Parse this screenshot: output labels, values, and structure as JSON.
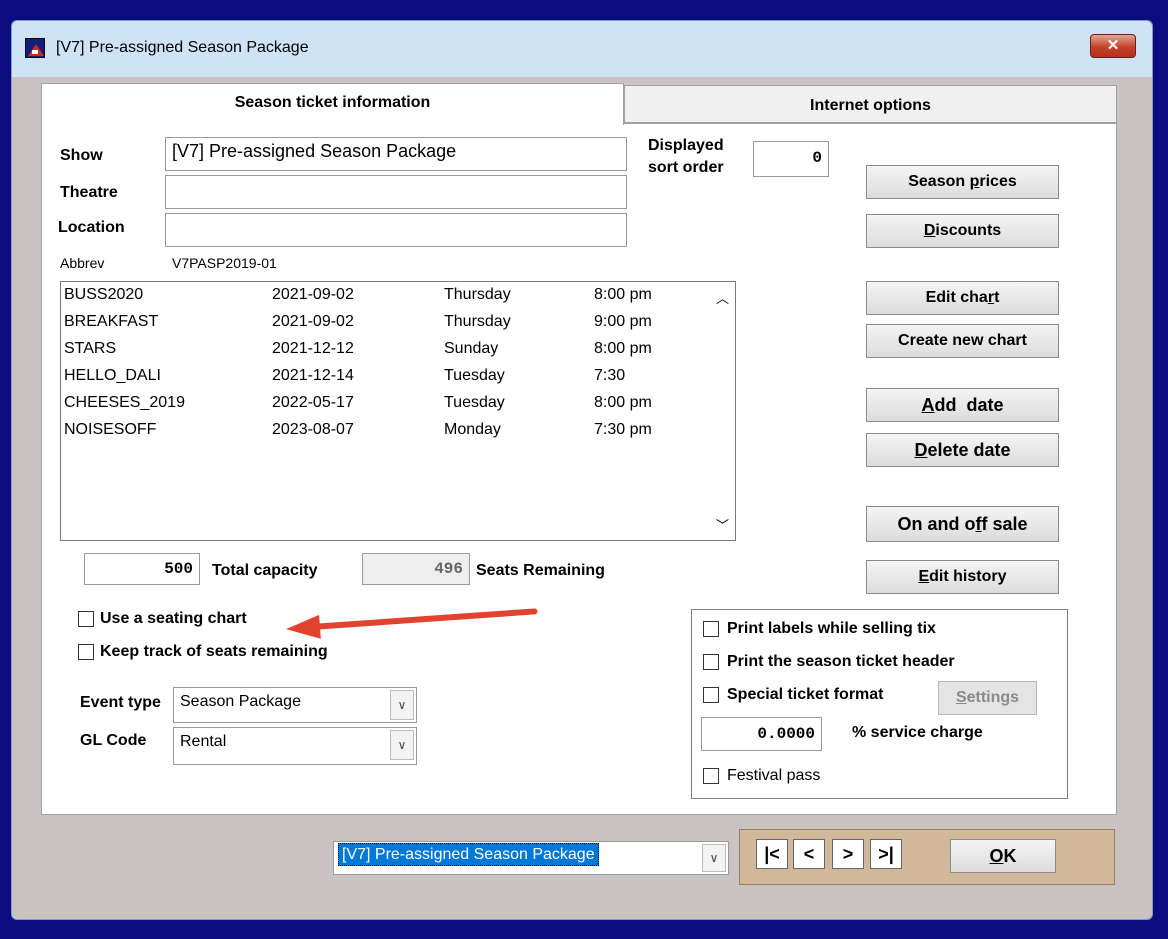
{
  "window": {
    "title": "[V7] Pre-assigned Season Package",
    "close_label": "✕"
  },
  "tabs": [
    {
      "label": "Season ticket information"
    },
    {
      "label": "Internet options"
    }
  ],
  "form": {
    "show_label": "Show",
    "show_value": "[V7] Pre-assigned Season Package",
    "theatre_label": "Theatre",
    "theatre_value": "",
    "location_label": "Location",
    "location_value": "",
    "abbrev_label": "Abbrev",
    "abbrev_value": "V7PASP2019-01",
    "sort_label_1": "Displayed",
    "sort_label_2": "sort order",
    "sort_value": "0"
  },
  "dates": [
    {
      "code": "BUSS2020",
      "date": "2021-09-02",
      "day": "Thursday",
      "time": "8:00 pm"
    },
    {
      "code": "BREAKFAST",
      "date": "2021-09-02",
      "day": "Thursday",
      "time": "9:00 pm"
    },
    {
      "code": "STARS",
      "date": "2021-12-12",
      "day": "Sunday",
      "time": "8:00 pm"
    },
    {
      "code": "HELLO_DALI",
      "date": "2021-12-14",
      "day": "Tuesday",
      "time": "7:30"
    },
    {
      "code": "CHEESES_2019",
      "date": "2022-05-17",
      "day": "Tuesday",
      "time": "8:00 pm"
    },
    {
      "code": "NOISESOFF",
      "date": "2023-08-07",
      "day": "Monday",
      "time": "7:30 pm"
    }
  ],
  "scroll": {
    "up": "︿",
    "down": "﹀"
  },
  "capacity": {
    "total_value": "500",
    "total_label": "Total capacity",
    "remaining_value": "496",
    "remaining_label": "Seats Remaining"
  },
  "checkboxes": {
    "seating_chart": "Use a seating chart",
    "keep_track": "Keep track of seats remaining",
    "print_labels": "Print labels while selling tix",
    "print_header": "Print the season ticket header",
    "special_format": "Special ticket format",
    "festival_pass": "Festival pass"
  },
  "event": {
    "event_type_label": "Event type",
    "event_type_value": "Season Package",
    "gl_label": "GL Code",
    "gl_value": "Rental"
  },
  "service": {
    "value": "0.0000",
    "label": "% service charge"
  },
  "buttons": {
    "season_prices": "Season prices",
    "discounts": "Discounts",
    "edit_chart": "Edit chart",
    "create_chart": "Create new chart",
    "add_date": "Add  date",
    "delete_date": "Delete date",
    "on_off_sale": "On and off sale",
    "edit_history": "Edit history",
    "settings": "Settings",
    "ok": "OK"
  },
  "nav": {
    "first": "|<",
    "prev": "<",
    "next": ">",
    "last": ">|"
  },
  "footer": {
    "selector_value": "[V7] Pre-assigned Season Package"
  }
}
